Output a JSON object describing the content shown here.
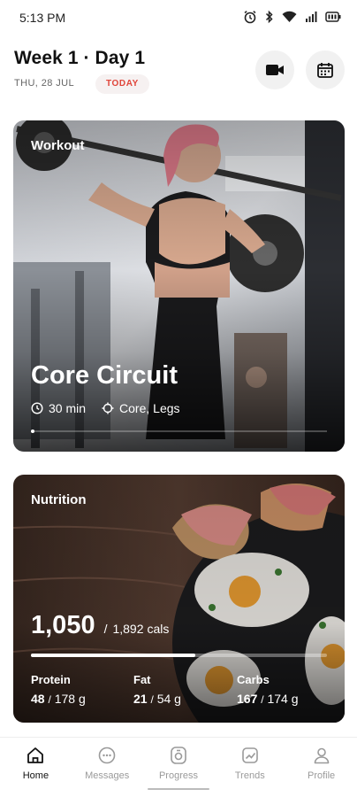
{
  "status_bar": {
    "time": "5:13 PM",
    "icons": [
      "alarm-icon",
      "bluetooth-icon",
      "wifi-icon",
      "signal-icon",
      "battery-icon"
    ]
  },
  "header": {
    "title": "Week 1 · Day 1",
    "date": "THU, 28 JUL",
    "badge": "TODAY",
    "video_button_icon": "video-camera-icon",
    "calendar_button_icon": "calendar-icon"
  },
  "workout": {
    "label": "Workout",
    "title": "Core Circuit",
    "duration": "30 min",
    "focus": "Core, Legs",
    "slides_count": 1,
    "active_slide": 1
  },
  "nutrition": {
    "label": "Nutrition",
    "calories_consumed": "1,050",
    "calories_goal": "1,892",
    "calories_unit": "cals",
    "progress_fraction": 0.555,
    "macros": [
      {
        "name": "Protein",
        "current": "48",
        "goal": "178 g"
      },
      {
        "name": "Fat",
        "current": "21",
        "goal": "54 g"
      },
      {
        "name": "Carbs",
        "current": "167",
        "goal": "174 g"
      }
    ]
  },
  "nav": {
    "items": [
      {
        "label": "Home",
        "icon": "home-icon",
        "active": true
      },
      {
        "label": "Messages",
        "icon": "messages-icon",
        "active": false
      },
      {
        "label": "Progress",
        "icon": "progress-icon",
        "active": false
      },
      {
        "label": "Trends",
        "icon": "trends-icon",
        "active": false
      },
      {
        "label": "Profile",
        "icon": "profile-icon",
        "active": false
      }
    ]
  },
  "colors": {
    "accent": "#e0453a",
    "text_primary": "#111111",
    "nav_inactive": "#9a9a9a"
  }
}
